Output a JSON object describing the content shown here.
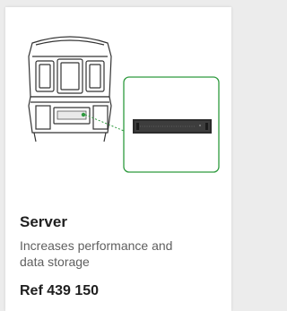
{
  "product": {
    "name": "Server",
    "description": "Increases performance and data storage",
    "reference": "Ref 439 150",
    "accent_color": "#2e9a3e"
  }
}
